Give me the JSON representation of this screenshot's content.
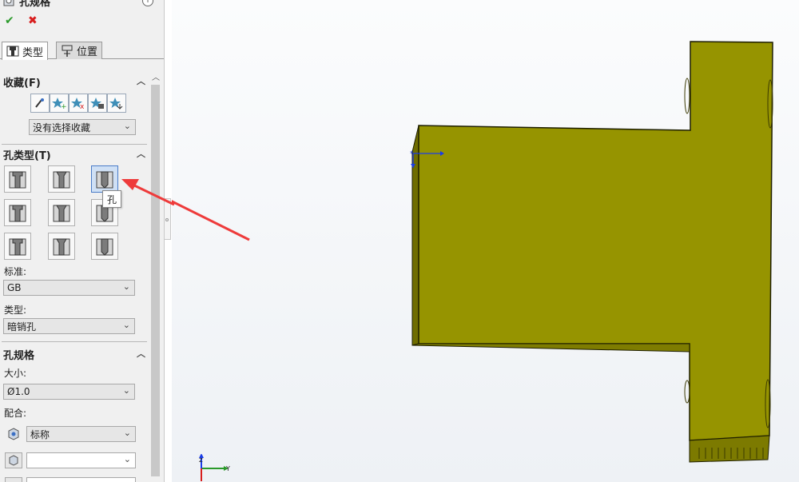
{
  "panel": {
    "title": "孔规格",
    "ok_icon": "check-icon",
    "cancel_icon": "close-icon"
  },
  "tabs": [
    {
      "label": "类型",
      "icon": "hole-type-icon"
    },
    {
      "label": "位置",
      "icon": "position-icon"
    }
  ],
  "favorites": {
    "header": "收藏(F)",
    "buttons": [
      "apply-defaults-icon",
      "add-favorite-icon",
      "delete-favorite-icon",
      "save-favorite-icon",
      "load-favorite-icon"
    ],
    "selected": "没有选择收藏"
  },
  "hole_type": {
    "header": "孔类型(T)",
    "tooltip": "孔",
    "selected_index": 2,
    "types": [
      "counterbore",
      "countersink",
      "hole",
      "straight-tap",
      "tapered-tap",
      "legacy-hole",
      "counterbore-slot",
      "countersink-slot",
      "slot"
    ]
  },
  "standard": {
    "label": "标准:",
    "value": "GB"
  },
  "type": {
    "label": "类型:",
    "value": "暗销孔"
  },
  "hole_spec": {
    "header": "孔规格",
    "size_label": "大小:",
    "size_value": "Ø1.0",
    "fit_label": "配合:",
    "fit_value": "标称",
    "extra_value": ""
  },
  "triad": {
    "x_label": "Y",
    "y_label": "Z"
  },
  "colors": {
    "part_face": "#969400",
    "part_edge": "#1e1e00",
    "arrow": "#ee3b3b",
    "selection_blue": "#1a3de8"
  }
}
